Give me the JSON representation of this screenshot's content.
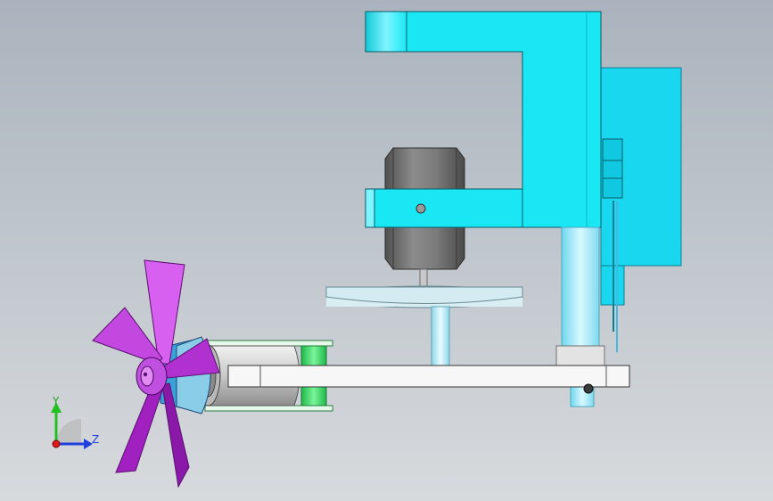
{
  "viewport": {
    "background_top": "#aab3bd",
    "background_bottom": "#d7dadd"
  },
  "triad": {
    "y_label": "Y",
    "z_label": "Z",
    "y_color": "#20c020",
    "z_color": "#2040e0",
    "origin_color": "#e01818"
  },
  "colors": {
    "frame": "#19e8f4",
    "frame_shade": "#12c9d6",
    "panel": "#1ad7f0",
    "motor_body": "#7d7d7d",
    "motor_dark": "#5a5a5a",
    "disc": "#cfe8ee",
    "shaft": "#b9e6f0",
    "arm": "#f7f7f7",
    "cylinder": "#d3d3d3",
    "green_part": "#34e05a",
    "fan": "#d860f0",
    "fan_dark": "#a020c0",
    "hub": "#c050e0",
    "blue_cup": "#3aa0d8"
  }
}
